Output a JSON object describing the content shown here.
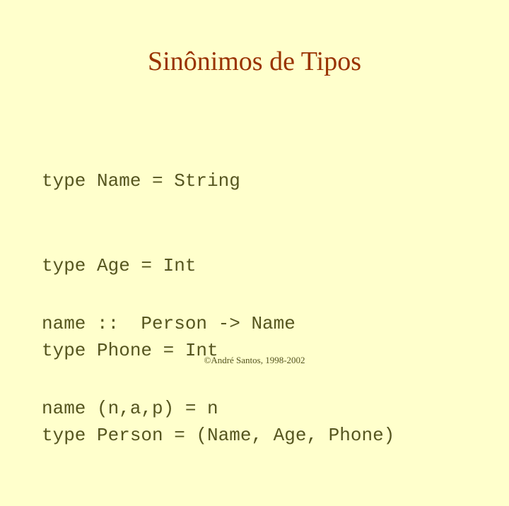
{
  "slide": {
    "title": "Sinônimos de Tipos",
    "background_color": "#ffffcc",
    "title_color": "#993300",
    "code_color": "#55551f",
    "code_block_1": [
      "type Name = String",
      "type Age = Int",
      "type Phone = Int",
      "type Person = (Name, Age, Phone)"
    ],
    "code_block_2": [
      "name ::  Person -> Name",
      "name (n,a,p) = n"
    ],
    "footer": "©André Santos, 1998-2002"
  }
}
